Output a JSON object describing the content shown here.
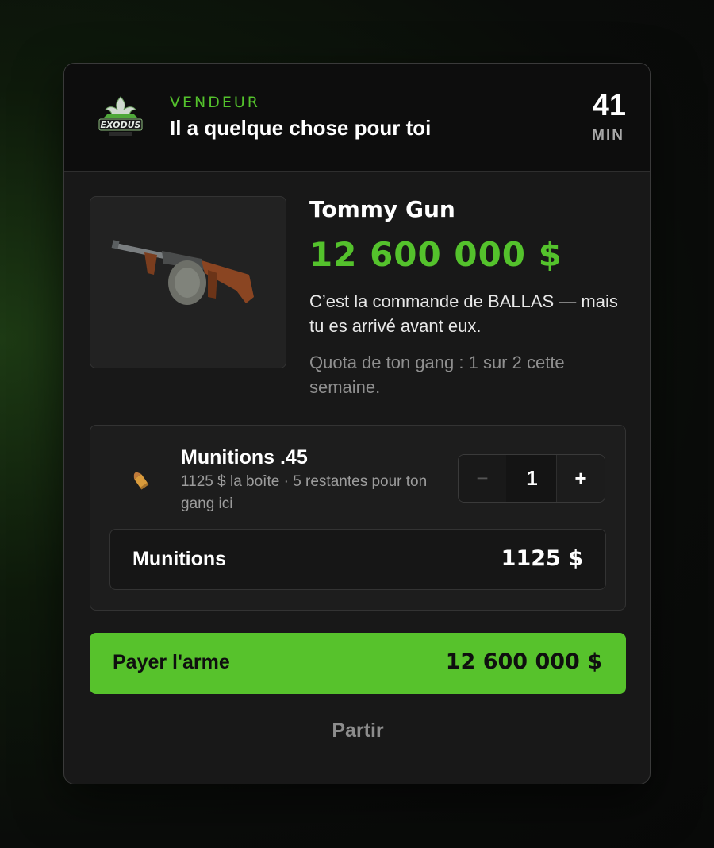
{
  "header": {
    "logo_icon": "exodus-logo",
    "seller_label": "VENDEUR",
    "seller_message": "Il a quelque chose pour toi",
    "timer_value": "41",
    "timer_unit": "MIN"
  },
  "item": {
    "image_icon": "tommy-gun-image",
    "name": "Tommy Gun",
    "price": "12 600 000 $",
    "description": "C’est la commande de BALLAS — mais tu es arrivé avant eux.",
    "quota": "Quota de ton gang : 1 sur 2 cette semaine."
  },
  "ammo": {
    "icon": "bullet-icon",
    "name": "Munitions .45",
    "detail": "1125 $ la boîte · 5 restantes pour ton gang ici",
    "quantity": "1",
    "minus_label": "−",
    "plus_label": "+",
    "summary_label": "Munitions",
    "summary_value": "1125 $"
  },
  "actions": {
    "pay_label": "Payer l'arme",
    "pay_amount": "12 600 000 $",
    "leave_label": "Partir"
  },
  "colors": {
    "accent": "#57c22c",
    "card_bg": "#181818",
    "header_bg": "#0d0d0d"
  }
}
